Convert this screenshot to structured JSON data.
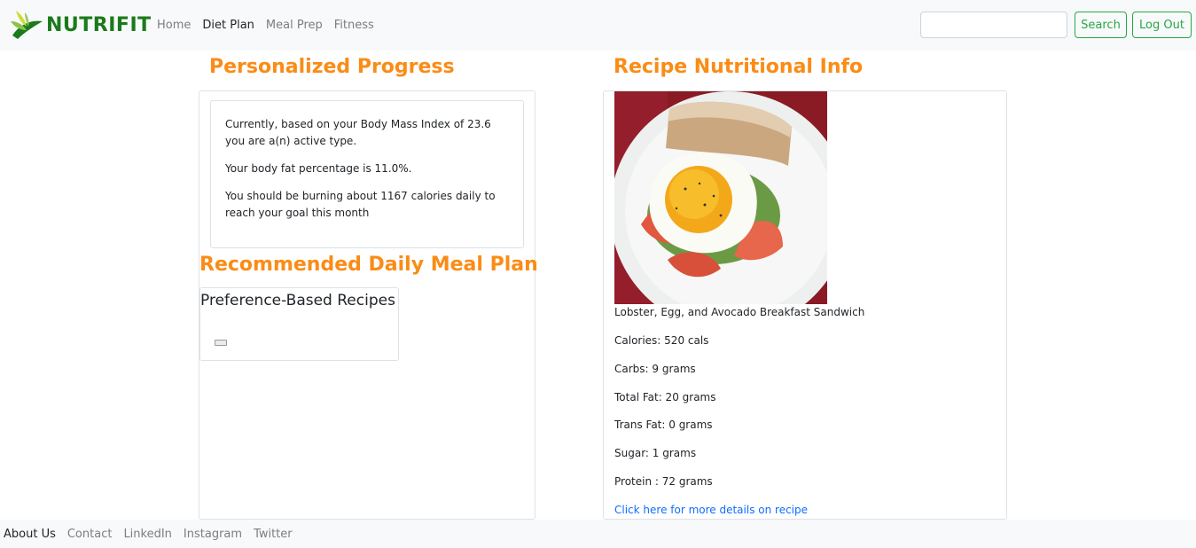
{
  "brand": {
    "name": "NUTRIFIT",
    "icon": "leaf-logo-icon"
  },
  "nav": {
    "links": [
      {
        "label": "Home",
        "active": false
      },
      {
        "label": "Diet Plan",
        "active": true
      },
      {
        "label": "Meal Prep",
        "active": false
      },
      {
        "label": "Fitness",
        "active": false
      }
    ],
    "search": {
      "placeholder": "",
      "value": "",
      "button_label": "Search"
    },
    "logout_label": "Log Out"
  },
  "progress": {
    "heading": "Personalized Progress",
    "lines": [
      "Currently, based on your Body Mass Index of 23.6 you are a(n) active type.",
      "Your body fat percentage is 11.0%.",
      "You should be burning about 1167 calories daily to reach your goal this month"
    ]
  },
  "meal_plan": {
    "heading": "Recommended Daily Meal Plan",
    "card_title": "Preference-Based Recipes"
  },
  "recipe": {
    "heading": "Recipe Nutritional Info",
    "name": "Lobster, Egg, and Avocado Breakfast Sandwich",
    "calories": "Calories: 520 cals",
    "carbs": "Carbs: 9 grams",
    "total_fat": "Total Fat: 20 grams",
    "trans_fat": "Trans Fat: 0 grams",
    "sugar": "Sugar: 1 grams",
    "protein": "Protein : 72 grams",
    "link_label": "Click here for more details on recipe"
  },
  "footer": {
    "links": [
      "About Us",
      "Contact",
      "LinkedIn",
      "Instagram",
      "Twitter"
    ]
  },
  "colors": {
    "brand_green": "#1b7a1b",
    "accent_orange": "#fa8c16",
    "button_green": "#28a745",
    "link_blue": "#0d6efd"
  }
}
